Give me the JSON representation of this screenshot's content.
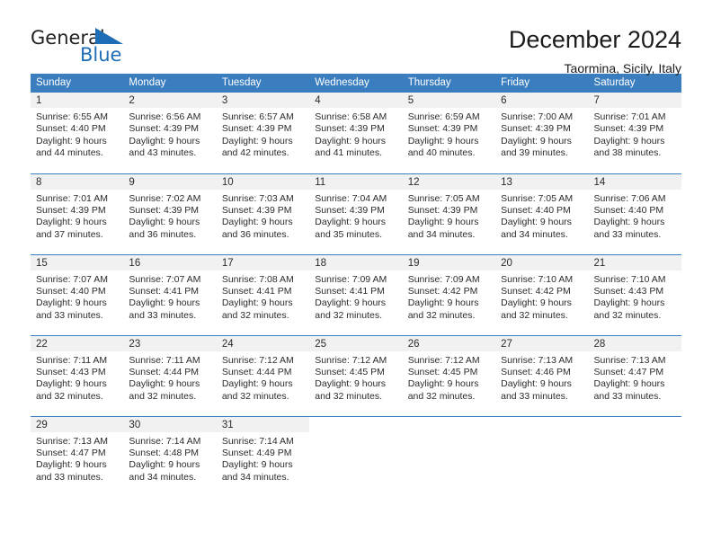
{
  "brand": {
    "name_part1": "General",
    "name_part2": "Blue",
    "accent_color": "#1f6db5"
  },
  "header": {
    "title": "December 2024",
    "subtitle": "Taormina, Sicily, Italy"
  },
  "calendar": {
    "header_bg": "#3b7ebf",
    "daynum_bg": "#f1f1f1",
    "weekday_headers": [
      "Sunday",
      "Monday",
      "Tuesday",
      "Wednesday",
      "Thursday",
      "Friday",
      "Saturday"
    ],
    "weeks": [
      [
        {
          "day": "1",
          "sunrise": "Sunrise: 6:55 AM",
          "sunset": "Sunset: 4:40 PM",
          "daylight1": "Daylight: 9 hours",
          "daylight2": "and 44 minutes."
        },
        {
          "day": "2",
          "sunrise": "Sunrise: 6:56 AM",
          "sunset": "Sunset: 4:39 PM",
          "daylight1": "Daylight: 9 hours",
          "daylight2": "and 43 minutes."
        },
        {
          "day": "3",
          "sunrise": "Sunrise: 6:57 AM",
          "sunset": "Sunset: 4:39 PM",
          "daylight1": "Daylight: 9 hours",
          "daylight2": "and 42 minutes."
        },
        {
          "day": "4",
          "sunrise": "Sunrise: 6:58 AM",
          "sunset": "Sunset: 4:39 PM",
          "daylight1": "Daylight: 9 hours",
          "daylight2": "and 41 minutes."
        },
        {
          "day": "5",
          "sunrise": "Sunrise: 6:59 AM",
          "sunset": "Sunset: 4:39 PM",
          "daylight1": "Daylight: 9 hours",
          "daylight2": "and 40 minutes."
        },
        {
          "day": "6",
          "sunrise": "Sunrise: 7:00 AM",
          "sunset": "Sunset: 4:39 PM",
          "daylight1": "Daylight: 9 hours",
          "daylight2": "and 39 minutes."
        },
        {
          "day": "7",
          "sunrise": "Sunrise: 7:01 AM",
          "sunset": "Sunset: 4:39 PM",
          "daylight1": "Daylight: 9 hours",
          "daylight2": "and 38 minutes."
        }
      ],
      [
        {
          "day": "8",
          "sunrise": "Sunrise: 7:01 AM",
          "sunset": "Sunset: 4:39 PM",
          "daylight1": "Daylight: 9 hours",
          "daylight2": "and 37 minutes."
        },
        {
          "day": "9",
          "sunrise": "Sunrise: 7:02 AM",
          "sunset": "Sunset: 4:39 PM",
          "daylight1": "Daylight: 9 hours",
          "daylight2": "and 36 minutes."
        },
        {
          "day": "10",
          "sunrise": "Sunrise: 7:03 AM",
          "sunset": "Sunset: 4:39 PM",
          "daylight1": "Daylight: 9 hours",
          "daylight2": "and 36 minutes."
        },
        {
          "day": "11",
          "sunrise": "Sunrise: 7:04 AM",
          "sunset": "Sunset: 4:39 PM",
          "daylight1": "Daylight: 9 hours",
          "daylight2": "and 35 minutes."
        },
        {
          "day": "12",
          "sunrise": "Sunrise: 7:05 AM",
          "sunset": "Sunset: 4:39 PM",
          "daylight1": "Daylight: 9 hours",
          "daylight2": "and 34 minutes."
        },
        {
          "day": "13",
          "sunrise": "Sunrise: 7:05 AM",
          "sunset": "Sunset: 4:40 PM",
          "daylight1": "Daylight: 9 hours",
          "daylight2": "and 34 minutes."
        },
        {
          "day": "14",
          "sunrise": "Sunrise: 7:06 AM",
          "sunset": "Sunset: 4:40 PM",
          "daylight1": "Daylight: 9 hours",
          "daylight2": "and 33 minutes."
        }
      ],
      [
        {
          "day": "15",
          "sunrise": "Sunrise: 7:07 AM",
          "sunset": "Sunset: 4:40 PM",
          "daylight1": "Daylight: 9 hours",
          "daylight2": "and 33 minutes."
        },
        {
          "day": "16",
          "sunrise": "Sunrise: 7:07 AM",
          "sunset": "Sunset: 4:41 PM",
          "daylight1": "Daylight: 9 hours",
          "daylight2": "and 33 minutes."
        },
        {
          "day": "17",
          "sunrise": "Sunrise: 7:08 AM",
          "sunset": "Sunset: 4:41 PM",
          "daylight1": "Daylight: 9 hours",
          "daylight2": "and 32 minutes."
        },
        {
          "day": "18",
          "sunrise": "Sunrise: 7:09 AM",
          "sunset": "Sunset: 4:41 PM",
          "daylight1": "Daylight: 9 hours",
          "daylight2": "and 32 minutes."
        },
        {
          "day": "19",
          "sunrise": "Sunrise: 7:09 AM",
          "sunset": "Sunset: 4:42 PM",
          "daylight1": "Daylight: 9 hours",
          "daylight2": "and 32 minutes."
        },
        {
          "day": "20",
          "sunrise": "Sunrise: 7:10 AM",
          "sunset": "Sunset: 4:42 PM",
          "daylight1": "Daylight: 9 hours",
          "daylight2": "and 32 minutes."
        },
        {
          "day": "21",
          "sunrise": "Sunrise: 7:10 AM",
          "sunset": "Sunset: 4:43 PM",
          "daylight1": "Daylight: 9 hours",
          "daylight2": "and 32 minutes."
        }
      ],
      [
        {
          "day": "22",
          "sunrise": "Sunrise: 7:11 AM",
          "sunset": "Sunset: 4:43 PM",
          "daylight1": "Daylight: 9 hours",
          "daylight2": "and 32 minutes."
        },
        {
          "day": "23",
          "sunrise": "Sunrise: 7:11 AM",
          "sunset": "Sunset: 4:44 PM",
          "daylight1": "Daylight: 9 hours",
          "daylight2": "and 32 minutes."
        },
        {
          "day": "24",
          "sunrise": "Sunrise: 7:12 AM",
          "sunset": "Sunset: 4:44 PM",
          "daylight1": "Daylight: 9 hours",
          "daylight2": "and 32 minutes."
        },
        {
          "day": "25",
          "sunrise": "Sunrise: 7:12 AM",
          "sunset": "Sunset: 4:45 PM",
          "daylight1": "Daylight: 9 hours",
          "daylight2": "and 32 minutes."
        },
        {
          "day": "26",
          "sunrise": "Sunrise: 7:12 AM",
          "sunset": "Sunset: 4:45 PM",
          "daylight1": "Daylight: 9 hours",
          "daylight2": "and 32 minutes."
        },
        {
          "day": "27",
          "sunrise": "Sunrise: 7:13 AM",
          "sunset": "Sunset: 4:46 PM",
          "daylight1": "Daylight: 9 hours",
          "daylight2": "and 33 minutes."
        },
        {
          "day": "28",
          "sunrise": "Sunrise: 7:13 AM",
          "sunset": "Sunset: 4:47 PM",
          "daylight1": "Daylight: 9 hours",
          "daylight2": "and 33 minutes."
        }
      ],
      [
        {
          "day": "29",
          "sunrise": "Sunrise: 7:13 AM",
          "sunset": "Sunset: 4:47 PM",
          "daylight1": "Daylight: 9 hours",
          "daylight2": "and 33 minutes."
        },
        {
          "day": "30",
          "sunrise": "Sunrise: 7:14 AM",
          "sunset": "Sunset: 4:48 PM",
          "daylight1": "Daylight: 9 hours",
          "daylight2": "and 34 minutes."
        },
        {
          "day": "31",
          "sunrise": "Sunrise: 7:14 AM",
          "sunset": "Sunset: 4:49 PM",
          "daylight1": "Daylight: 9 hours",
          "daylight2": "and 34 minutes."
        },
        {
          "day": "",
          "sunrise": "",
          "sunset": "",
          "daylight1": "",
          "daylight2": ""
        },
        {
          "day": "",
          "sunrise": "",
          "sunset": "",
          "daylight1": "",
          "daylight2": ""
        },
        {
          "day": "",
          "sunrise": "",
          "sunset": "",
          "daylight1": "",
          "daylight2": ""
        },
        {
          "day": "",
          "sunrise": "",
          "sunset": "",
          "daylight1": "",
          "daylight2": ""
        }
      ]
    ]
  }
}
